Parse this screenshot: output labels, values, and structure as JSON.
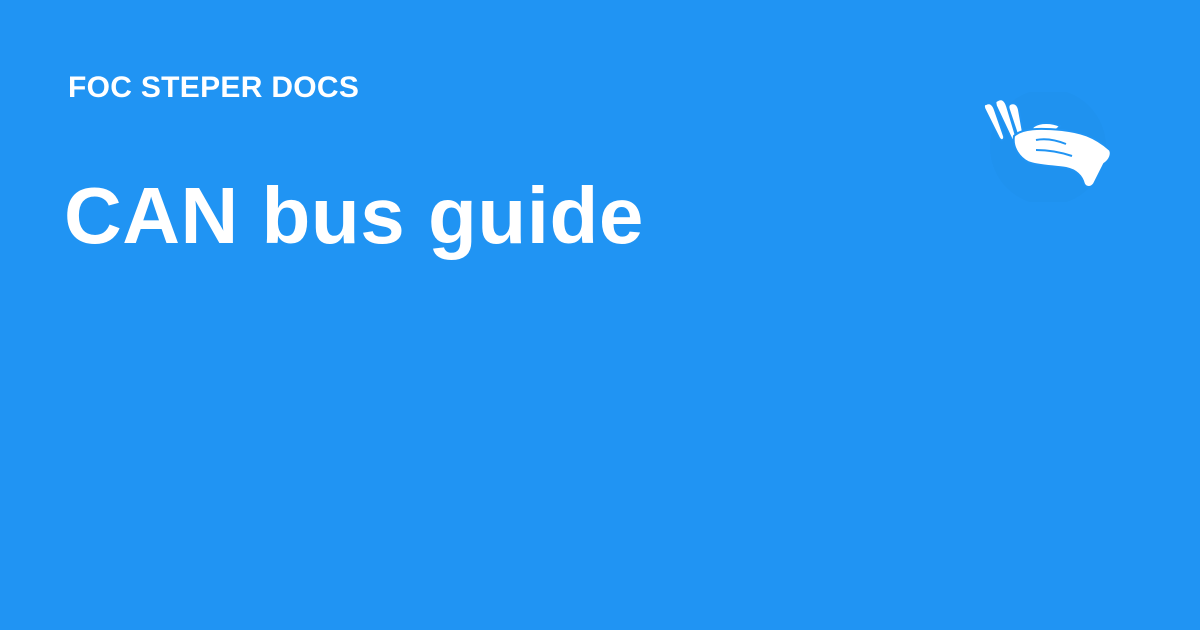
{
  "site": {
    "name": "FOC STEPER DOCS",
    "logo_icon": "hand-icon"
  },
  "page": {
    "title": "CAN bus guide"
  },
  "colors": {
    "background": "#2094f3",
    "text": "#ffffff"
  }
}
